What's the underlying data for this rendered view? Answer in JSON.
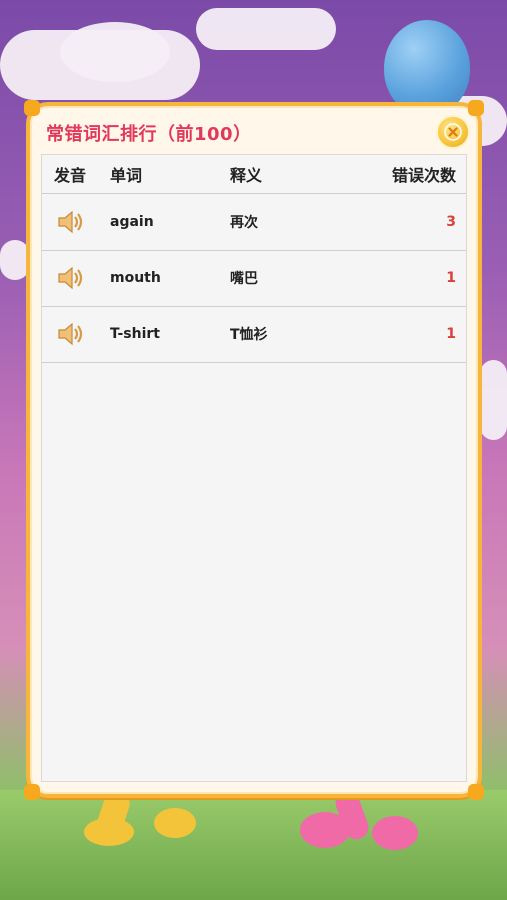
{
  "dialog": {
    "title": "常错词汇排行（前100）",
    "close_icon": "close-icon"
  },
  "table": {
    "headers": {
      "sound": "发音",
      "word": "单词",
      "meaning": "释义",
      "count": "错误次数"
    },
    "rows": [
      {
        "word": "again",
        "meaning": "再次",
        "count": "3",
        "icon": "speaker-icon"
      },
      {
        "word": "mouth",
        "meaning": "嘴巴",
        "count": "1",
        "icon": "speaker-icon"
      },
      {
        "word": "T-shirt",
        "meaning": "T恤衫",
        "count": "1",
        "icon": "speaker-icon"
      }
    ]
  },
  "colors": {
    "accent_border": "#f6b53c",
    "title": "#e2385c",
    "count": "#d8423a",
    "panel": "#f5f5f5"
  }
}
